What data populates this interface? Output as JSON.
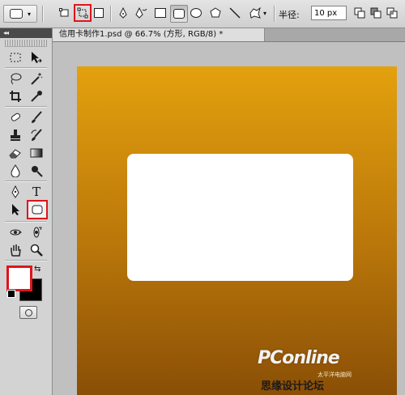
{
  "options_bar": {
    "preset_icon": "rounded-rect-preset-icon",
    "mode_icons": [
      "shape-layers-icon",
      "paths-icon",
      "fill-pixels-icon"
    ],
    "tool_icons": [
      "pen-icon",
      "freeform-pen-icon",
      "rectangle-icon",
      "rounded-rectangle-icon",
      "ellipse-icon",
      "polygon-icon",
      "line-icon",
      "custom-shape-icon"
    ],
    "radius_label": "半径:",
    "radius_value": "10 px",
    "highlight_color": "#e0141c"
  },
  "document": {
    "tab_title": "信用卡制作1.psd @ 66.7% (方形, RGB/8) *",
    "canvas_gradient": [
      "#e3a10e",
      "#8a4f06"
    ],
    "shape_color": "#ffffff"
  },
  "tools_panel": {
    "collapse_glyph": "◂◂",
    "tools": [
      "marquee-icon",
      "move-icon",
      "lasso-icon",
      "magic-wand-icon",
      "crop-icon",
      "eyedropper-icon",
      "healing-brush-icon",
      "brush-icon",
      "clone-stamp-icon",
      "history-brush-icon",
      "eraser-icon",
      "gradient-icon",
      "blur-icon",
      "dodge-icon",
      "pen-tool-icon",
      "type-icon",
      "path-selection-icon",
      "rounded-rect-tool-icon",
      "3d-rotate-icon",
      "3d-orbit-icon",
      "hand-icon",
      "zoom-icon"
    ],
    "type_tool_label": "T",
    "foreground_color": "#ffffff",
    "background_color": "#000000"
  },
  "watermark": {
    "brand": "PConline",
    "sub": "太平洋电脑网",
    "caption": "思缘设计论坛"
  }
}
